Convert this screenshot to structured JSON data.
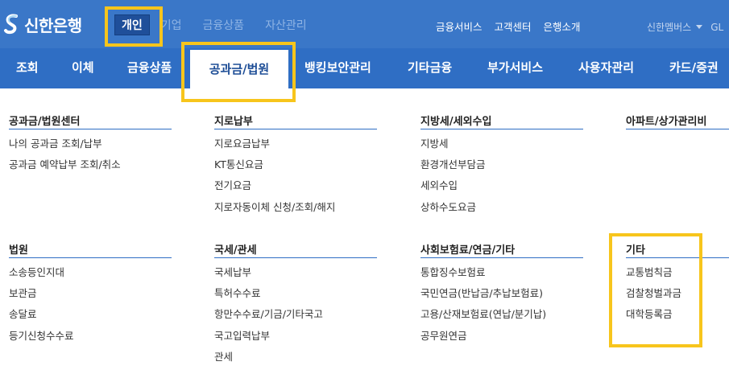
{
  "brand": {
    "name": "신한은행"
  },
  "top_tabs": [
    {
      "label": "개인",
      "active": true
    },
    {
      "label": "기업",
      "active": false
    },
    {
      "label": "금융상품",
      "active": false
    },
    {
      "label": "자산관리",
      "active": false
    }
  ],
  "top_links": [
    "금융서비스",
    "고객센터",
    "은행소개"
  ],
  "member": {
    "label": "신한멤버스",
    "extra": "GL"
  },
  "nav": [
    {
      "label": "조회"
    },
    {
      "label": "이체"
    },
    {
      "label": "금융상품"
    },
    {
      "label": "공과금/법원",
      "active": true
    },
    {
      "label": "뱅킹보안관리"
    },
    {
      "label": "기타금융"
    },
    {
      "label": "부가서비스"
    },
    {
      "label": "사용자관리"
    },
    {
      "label": "카드/증권"
    }
  ],
  "sections": [
    {
      "title": "공과금/법원센터",
      "items": [
        "나의 공과금 조회/납부",
        "공과금 예약납부 조회/취소"
      ]
    },
    {
      "title": "지로납부",
      "items": [
        "지로요금납부",
        "KT통신요금",
        "전기요금",
        "지로자동이체 신청/조회/해지"
      ]
    },
    {
      "title": "지방세/세외수입",
      "items": [
        "지방세",
        "환경개선부담금",
        "세외수입",
        "상하수도요금"
      ]
    },
    {
      "title": "아파트/상가관리비",
      "items": []
    },
    {
      "title": "법원",
      "items": [
        "소송등인지대",
        "보관금",
        "송달료",
        "등기신청수수료"
      ]
    },
    {
      "title": "국세/관세",
      "items": [
        "국세납부",
        "특허수수료",
        "항만수수료/기금/기타국고",
        "국고입력납부",
        "관세"
      ]
    },
    {
      "title": "사회보험료/연금/기타",
      "items": [
        "통합징수보험료",
        "국민연금(반납금/추납보험료)",
        "고용/산재보험료(연납/분기납)",
        "공무원연금"
      ]
    },
    {
      "title": "기타",
      "items": [
        "교통범칙금",
        "검찰청벌과금",
        "대학등록금"
      ]
    }
  ],
  "colors": {
    "topbar": "#3a77c8",
    "nav": "#2f6ec4",
    "active_tab": "#1f4f9a",
    "highlight": "#f7c51c",
    "section_rule": "#2f6ec4"
  },
  "icons": [
    "shinhan-logo-icon",
    "chevron-down-icon"
  ]
}
